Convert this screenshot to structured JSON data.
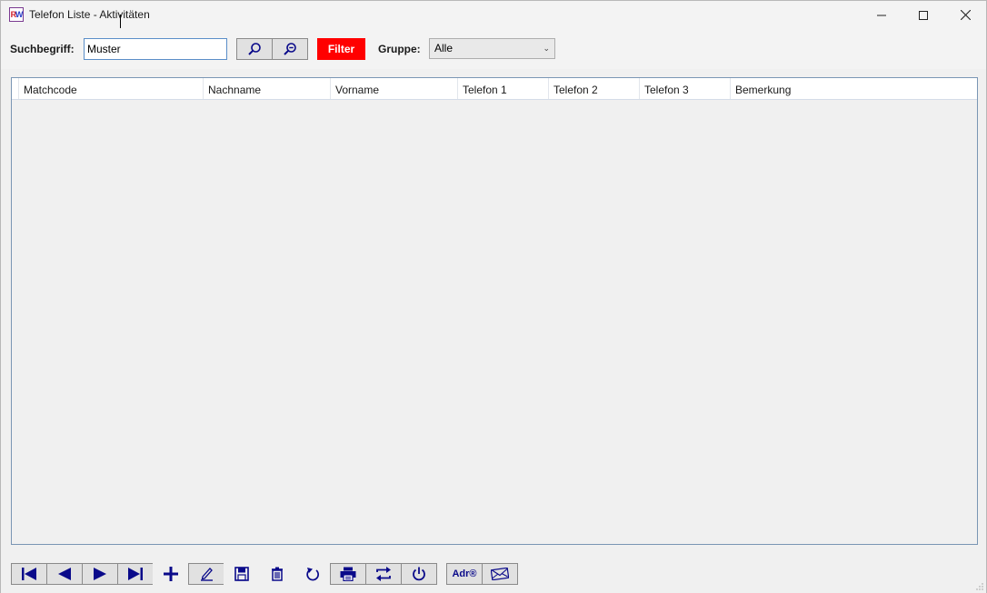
{
  "window": {
    "title": "Telefon Liste - Aktivitäten",
    "icon_label_r": "R",
    "icon_label_w": "W"
  },
  "toolbar": {
    "search_label": "Suchbegriff:",
    "search_value": "Muster",
    "search_button_icon": "search-icon",
    "clear_search_button_icon": "zoom-out-icon",
    "filter_label": "Filter",
    "filter_color": "#ff0000",
    "group_label": "Gruppe:",
    "group_selected": "Alle"
  },
  "grid": {
    "columns": [
      "Matchcode",
      "Nachname",
      "Vorname",
      "Telefon 1",
      "Telefon 2",
      "Telefon 3",
      "Bemerkung"
    ],
    "rows": []
  },
  "navigation": {
    "buttons": [
      "first-record-icon",
      "previous-record-icon",
      "next-record-icon",
      "last-record-icon",
      "add-icon",
      "edit-icon",
      "save-icon",
      "delete-icon",
      "undo-icon",
      "print-icon",
      "swap-icon",
      "power-icon",
      "address-icon",
      "mail-icon"
    ],
    "address_label": "Adr®",
    "accent_color": "#0a0a8a"
  }
}
